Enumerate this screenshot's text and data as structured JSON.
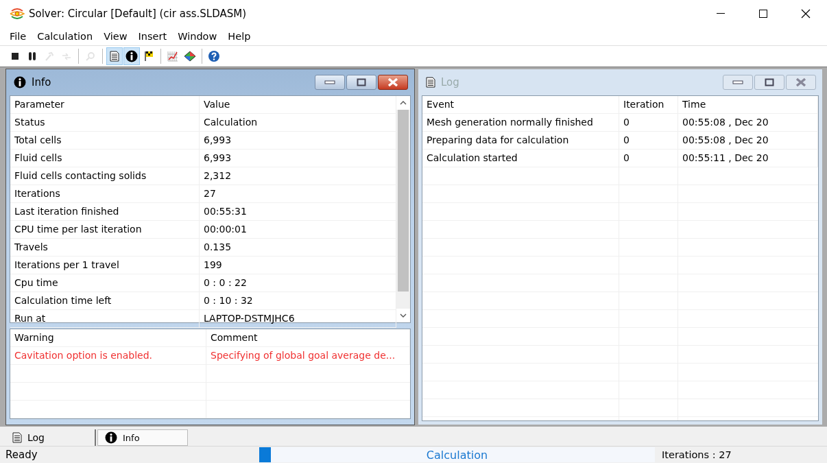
{
  "window": {
    "title": "Solver: Circular [Default] (cir ass.SLDASM)"
  },
  "menu": [
    "File",
    "Calculation",
    "View",
    "Insert",
    "Window",
    "Help"
  ],
  "toolbar": [
    {
      "kind": "stop",
      "disabled": false,
      "pressed": false
    },
    {
      "kind": "pause",
      "disabled": false,
      "pressed": false
    },
    {
      "kind": "wrench",
      "disabled": true,
      "pressed": false
    },
    {
      "kind": "arrows",
      "disabled": true,
      "pressed": false
    },
    {
      "kind": "separator"
    },
    {
      "kind": "probe",
      "disabled": true,
      "pressed": false
    },
    {
      "kind": "separator"
    },
    {
      "kind": "log",
      "disabled": false,
      "pressed": true
    },
    {
      "kind": "info",
      "disabled": false,
      "pressed": true
    },
    {
      "kind": "flag",
      "disabled": false,
      "pressed": false
    },
    {
      "kind": "separator"
    },
    {
      "kind": "chart",
      "disabled": false,
      "pressed": false
    },
    {
      "kind": "goal",
      "disabled": false,
      "pressed": false
    },
    {
      "kind": "separator"
    },
    {
      "kind": "help",
      "disabled": false,
      "pressed": false
    }
  ],
  "info_window": {
    "title": "Info",
    "active": true,
    "parameters": {
      "columns": [
        "Parameter",
        "Value"
      ],
      "rows": [
        [
          "Status",
          "Calculation"
        ],
        [
          "Total cells",
          "6,993"
        ],
        [
          "Fluid cells",
          "6,993"
        ],
        [
          "Fluid cells contacting solids",
          "2,312"
        ],
        [
          "Iterations",
          "27"
        ],
        [
          "Last iteration finished",
          "00:55:31"
        ],
        [
          "CPU time per last iteration",
          "00:00:01"
        ],
        [
          "Travels",
          "0.135"
        ],
        [
          "Iterations per 1 travel",
          "199"
        ],
        [
          "Cpu time",
          "0 : 0 : 22"
        ],
        [
          "Calculation time left",
          "0 : 10 : 32"
        ],
        [
          "Run at",
          "LAPTOP-DSTMJHC6"
        ]
      ]
    },
    "warnings": {
      "columns": [
        "Warning",
        "Comment"
      ],
      "rows": [
        [
          "Cavitation option is enabled.",
          "Specifying of global goal average de..."
        ]
      ]
    }
  },
  "log_window": {
    "title": "Log",
    "active": false,
    "columns": [
      "Event",
      "Iteration",
      "Time"
    ],
    "rows": [
      [
        "Mesh generation normally finished",
        "0",
        "00:55:08 , Dec 20"
      ],
      [
        "Preparing data for calculation",
        "0",
        "00:55:08 , Dec 20"
      ],
      [
        "Calculation started",
        "0",
        "00:55:11 , Dec 20"
      ]
    ]
  },
  "tabs": [
    {
      "label": "Log",
      "kind": "log",
      "selected": false
    },
    {
      "label": "Info",
      "kind": "info",
      "selected": true
    }
  ],
  "status_bar": {
    "state": "Ready",
    "progress": {
      "level": 0.03,
      "label": "Calculation"
    },
    "iterations": "Iterations : 27"
  }
}
